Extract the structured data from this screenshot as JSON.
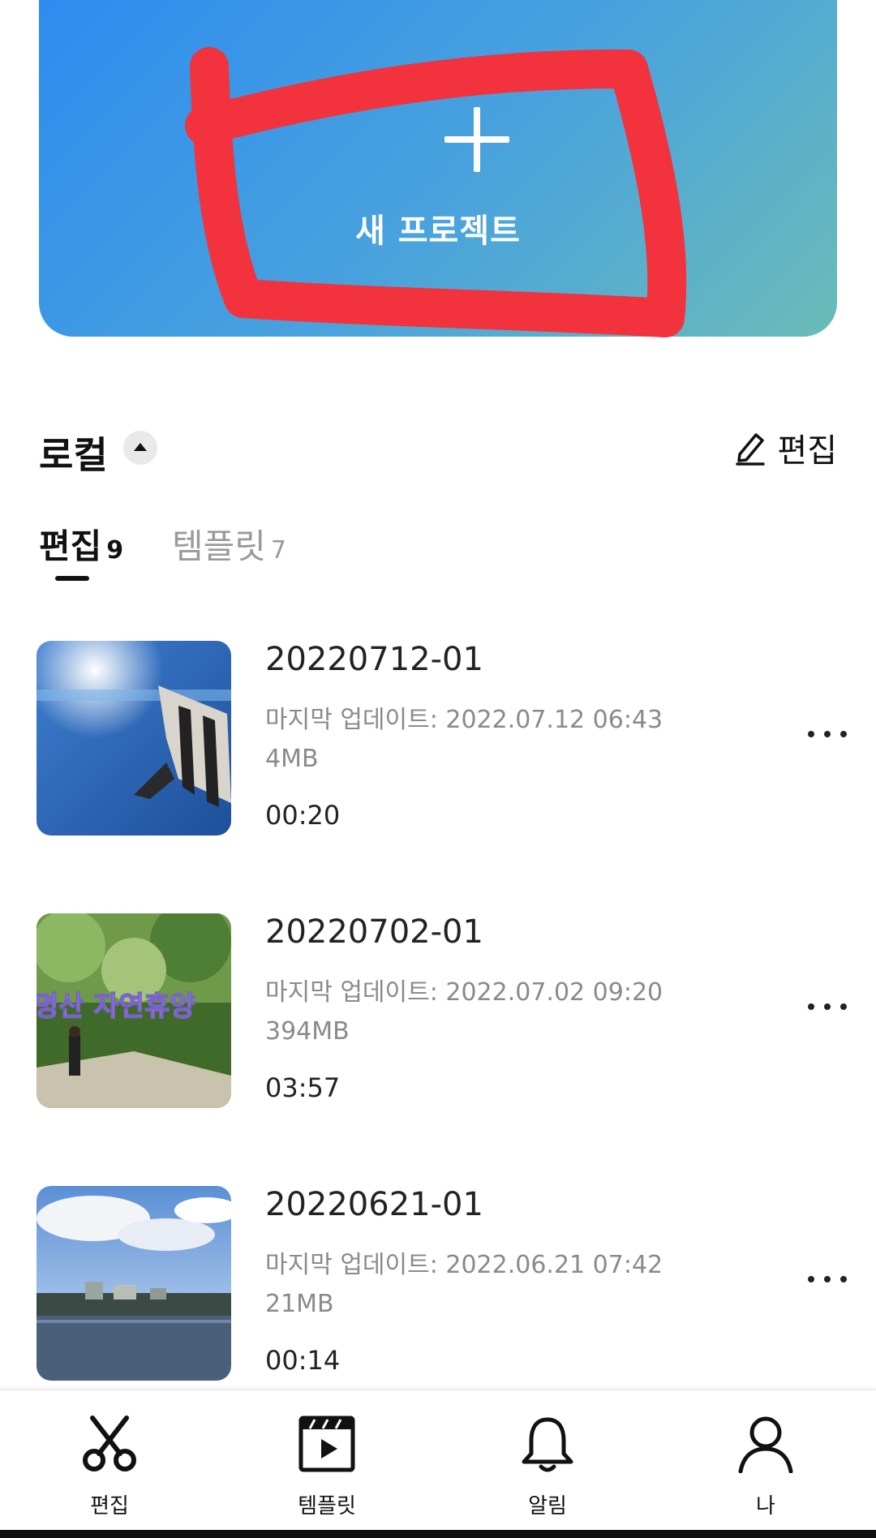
{
  "new_project": {
    "label": "새 프로젝트"
  },
  "local": {
    "title": "로컬",
    "edit_label": "편집"
  },
  "tabs": [
    {
      "label": "편집",
      "count": "9",
      "active": true
    },
    {
      "label": "템플릿",
      "count": "7",
      "active": false
    }
  ],
  "projects": [
    {
      "title": "20220712-01",
      "updated": "마지막 업데이트: 2022.07.12 06:43",
      "size": "4MB",
      "duration": "00:20"
    },
    {
      "title": "20220702-01",
      "updated": "마지막 업데이트: 2022.07.02 09:20",
      "size": "394MB",
      "duration": "03:57",
      "thumb_text": "명산 자연휴양"
    },
    {
      "title": "20220621-01",
      "updated": "마지막 업데이트: 2022.06.21 07:42",
      "size": "21MB",
      "duration": "00:14"
    }
  ],
  "bottom_nav": [
    {
      "label": "편집",
      "icon": "scissors-icon"
    },
    {
      "label": "템플릿",
      "icon": "clapperboard-icon"
    },
    {
      "label": "알림",
      "icon": "bell-icon"
    },
    {
      "label": "나",
      "icon": "person-icon"
    }
  ],
  "colors": {
    "banner_start": "#2d8cf0",
    "banner_end": "#6bbcb8",
    "scribble": "#f2333d",
    "text_primary": "#111111",
    "text_secondary": "#8a8a8a"
  }
}
